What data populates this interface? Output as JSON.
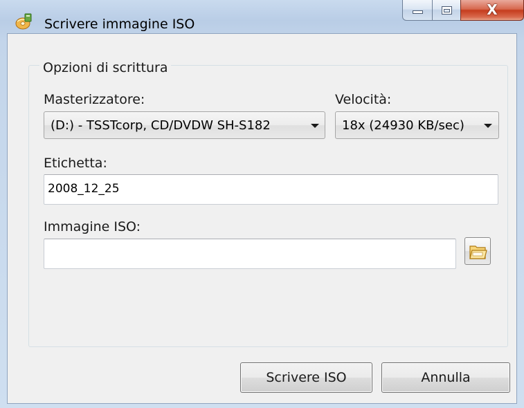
{
  "window": {
    "title": "Scrivere immagine ISO"
  },
  "caption": {
    "close_glyph": "X"
  },
  "group": {
    "legend": "Opzioni di scrittura"
  },
  "burner": {
    "label": "Masterizzatore:",
    "selected": "(D:) - TSSTcorp, CD/DVDW SH-S182"
  },
  "speed": {
    "label": "Velocità:",
    "selected": "18x (24930 KB/sec)"
  },
  "label_field": {
    "label": "Etichetta:",
    "value": "2008_12_25"
  },
  "iso_field": {
    "label": "Immagine ISO:",
    "value": ""
  },
  "buttons": {
    "write": "Scrivere ISO",
    "cancel": "Annulla"
  },
  "icons": {
    "app": "burn-disc-icon",
    "browse": "folder-open-icon"
  }
}
